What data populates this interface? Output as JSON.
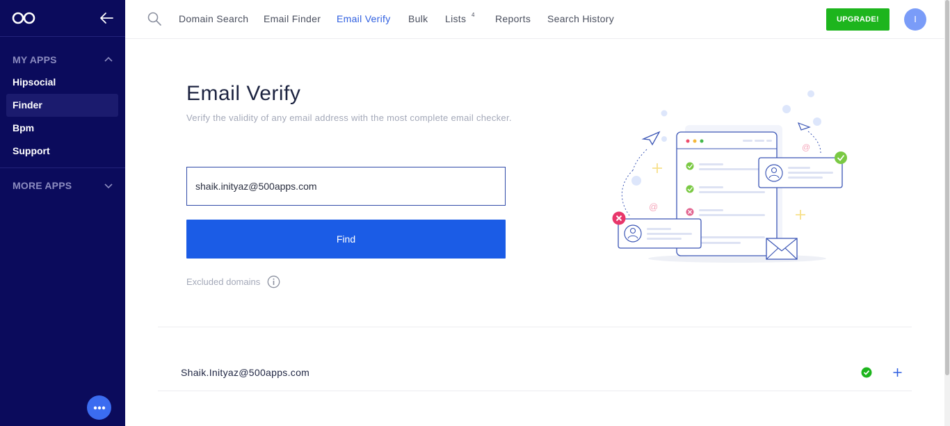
{
  "sidebar": {
    "my_apps_label": "MY APPS",
    "items": [
      {
        "label": "Hipsocial"
      },
      {
        "label": "Finder"
      },
      {
        "label": "Bpm"
      },
      {
        "label": "Support"
      }
    ],
    "more_apps_label": "MORE APPS",
    "active_item": "Finder"
  },
  "nav": {
    "items": [
      {
        "label": "Domain Search"
      },
      {
        "label": "Email Finder"
      },
      {
        "label": "Email Verify"
      },
      {
        "label": "Bulk"
      },
      {
        "label": "Lists"
      },
      {
        "label": "Reports"
      },
      {
        "label": "Search History"
      }
    ],
    "active": "Email Verify",
    "lists_badge": "4",
    "upgrade_label": "UPGRADE!",
    "avatar_initial": "I"
  },
  "main": {
    "title": "Email Verify",
    "subtitle": "Verify the validity of any email address with the most complete email checker.",
    "email_value": "shaik.inityaz@500apps.com",
    "find_label": "Find",
    "excluded_label": "Excluded domains"
  },
  "result": {
    "email": "Shaik.Inityaz@500apps.com",
    "status": "valid"
  },
  "colors": {
    "sidebar_bg": "#0b0b5c",
    "accent": "#1b5ce6",
    "upgrade": "#1db51d",
    "valid": "#1db51d"
  }
}
